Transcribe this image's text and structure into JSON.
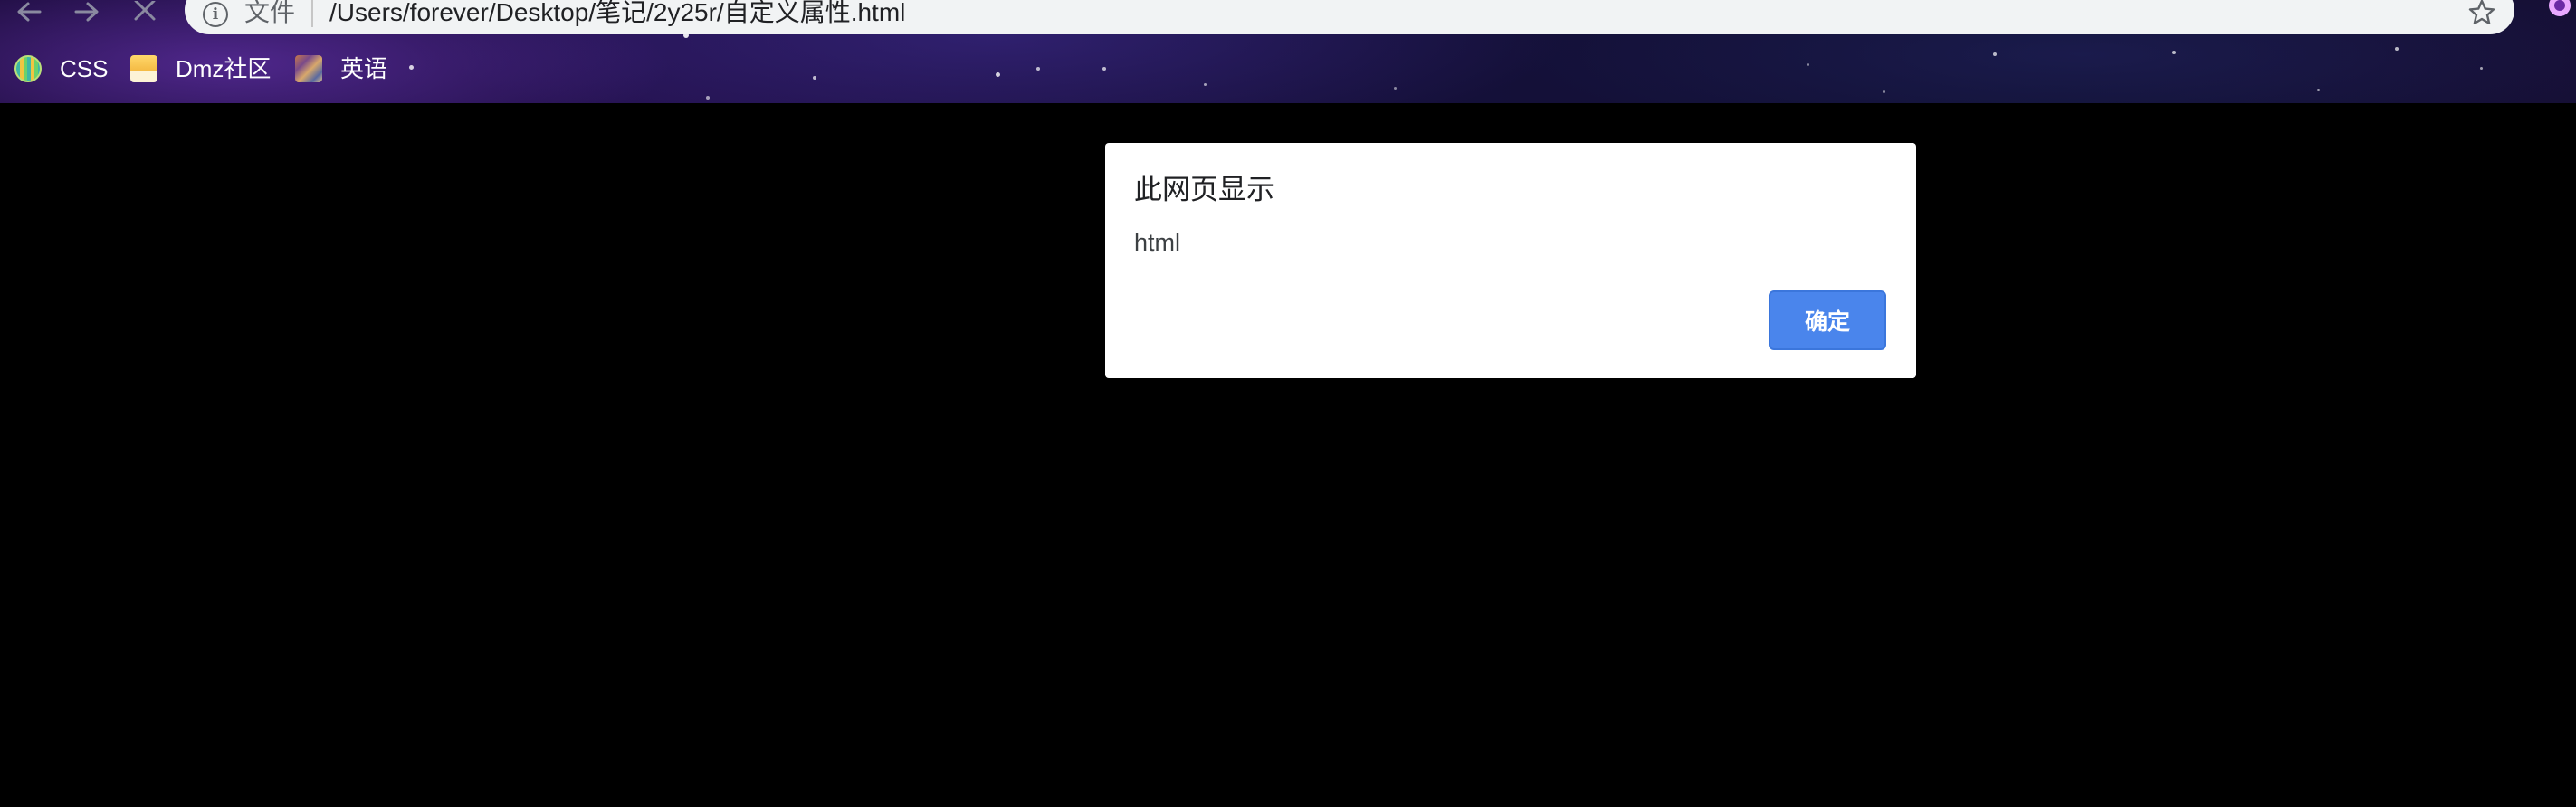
{
  "browser": {
    "address": {
      "scheme_label": "文件",
      "url": "/Users/forever/Desktop/笔记/2y25r/自定义属性.html"
    },
    "nav": {
      "back_icon": "arrow-left-icon",
      "forward_icon": "arrow-right-icon",
      "stop_icon": "close-icon"
    },
    "bookmarks": [
      {
        "label": "CSS",
        "icon": "css-bookmark-icon"
      },
      {
        "label": "Dmz社区",
        "icon": "folder-bookmark-icon"
      },
      {
        "label": "英语",
        "icon": "image-bookmark-icon"
      }
    ]
  },
  "dialog": {
    "title": "此网页显示",
    "message": "html",
    "ok_label": "确定"
  },
  "colors": {
    "dialog_button": "#4a85ec",
    "page_background": "#000000",
    "toolbar_theme": "#1a0b3a"
  }
}
